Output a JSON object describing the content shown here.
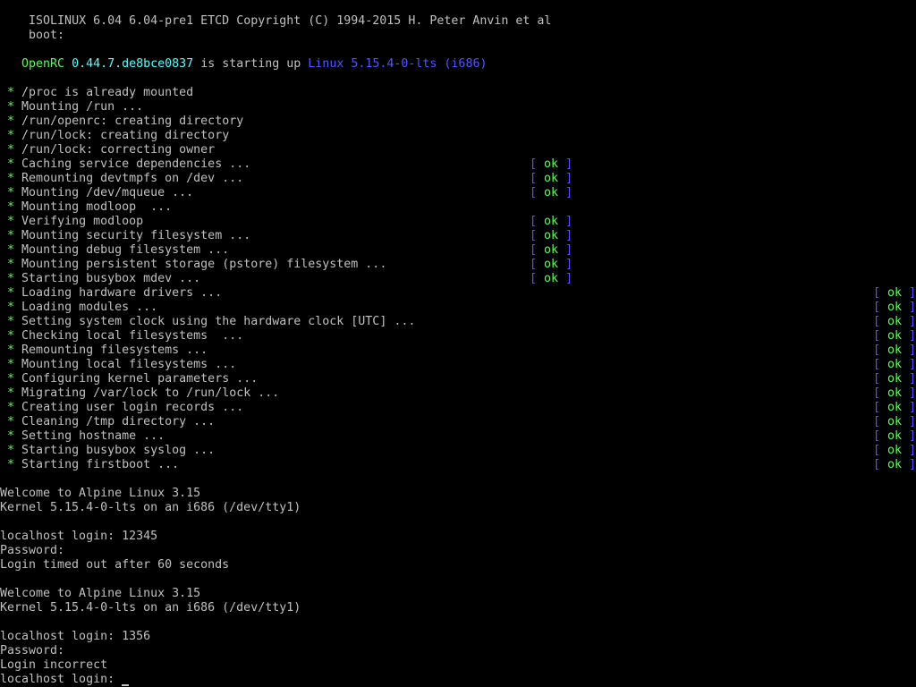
{
  "screen": {
    "colors": {
      "background": "#000000",
      "text": "#c0c0c0",
      "bullet": "#55ff55",
      "bracket": "#5555ff",
      "ok": "#55ff55",
      "kernel": "#5555ff",
      "version": "#55ffff"
    }
  },
  "boot_header": {
    "line1": "ISOLINUX 6.04 6.04-pre1 ETCD Copyright (C) 1994-2015 H. Peter Anvin et al",
    "line2": "boot:"
  },
  "openrc_banner": {
    "name": "OpenRC",
    "version": "0.44.7.de8bce0837",
    "middle": "is starting up",
    "kernel": "Linux 5.15.4-0-lts",
    "arch": "(i686)"
  },
  "status_tokens": {
    "bullet": "*",
    "open": "[",
    "ok": "ok",
    "close": "]"
  },
  "service_lines": [
    {
      "text": "/proc is already mounted",
      "status": ""
    },
    {
      "text": "Mounting /run ...",
      "status": ""
    },
    {
      "text": "/run/openrc: creating directory",
      "status": ""
    },
    {
      "text": "/run/lock: creating directory",
      "status": ""
    },
    {
      "text": "/run/lock: correcting owner",
      "status": ""
    },
    {
      "text": "Caching service dependencies ...",
      "status": "ok"
    },
    {
      "text": "Remounting devtmpfs on /dev ...",
      "status": "ok"
    },
    {
      "text": "Mounting /dev/mqueue ...",
      "status": "ok"
    },
    {
      "text": "Mounting modloop  ...",
      "status": ""
    },
    {
      "text": "Verifying modloop",
      "status": "ok"
    },
    {
      "text": "Mounting security filesystem ...",
      "status": "ok"
    },
    {
      "text": "Mounting debug filesystem ...",
      "status": "ok"
    },
    {
      "text": "Mounting persistent storage (pstore) filesystem ...",
      "status": "ok"
    },
    {
      "text": "Starting busybox mdev ...",
      "status": "ok"
    },
    {
      "text": "Loading hardware drivers ...",
      "status": "ok"
    },
    {
      "text": "Loading modules ...",
      "status": "ok"
    },
    {
      "text": "Setting system clock using the hardware clock [UTC] ...",
      "status": "ok"
    },
    {
      "text": "Checking local filesystems  ...",
      "status": "ok"
    },
    {
      "text": "Remounting filesystems ...",
      "status": "ok"
    },
    {
      "text": "Mounting local filesystems ...",
      "status": "ok"
    },
    {
      "text": "Configuring kernel parameters ...",
      "status": "ok"
    },
    {
      "text": "Migrating /var/lock to /run/lock ...",
      "status": "ok"
    },
    {
      "text": "Creating user login records ...",
      "status": "ok"
    },
    {
      "text": "Cleaning /tmp directory ...",
      "status": "ok"
    },
    {
      "text": "Setting hostname ...",
      "status": "ok"
    },
    {
      "text": "Starting busybox syslog ...",
      "status": "ok"
    },
    {
      "text": "Starting firstboot ...",
      "status": "ok"
    }
  ],
  "login_session": {
    "welcome1": "Welcome to Alpine Linux 3.15",
    "kernel1": "Kernel 5.15.4-0-lts on an i686 (/dev/tty1)",
    "login_prompt1": "localhost login: 12345",
    "password_prompt1": "Password:",
    "timeout_msg": "Login timed out after 60 seconds",
    "welcome2": "Welcome to Alpine Linux 3.15",
    "kernel2": "Kernel 5.15.4-0-lts on an i686 (/dev/tty1)",
    "login_prompt2": "localhost login: 1356",
    "password_prompt2": "Password:",
    "incorrect_msg": "Login incorrect",
    "login_prompt3": "localhost login: "
  }
}
